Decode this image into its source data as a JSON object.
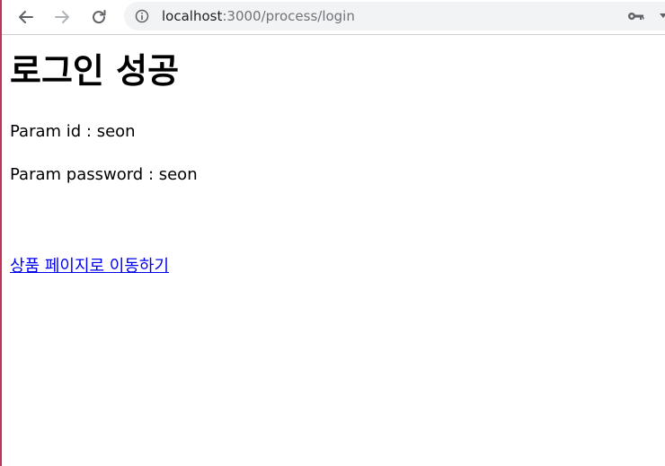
{
  "browser": {
    "url_host": "localhost",
    "url_rest": ":3000/process/login",
    "back_icon": "back-arrow-icon",
    "forward_icon": "forward-arrow-icon",
    "reload_icon": "reload-icon",
    "info_icon": "info-icon",
    "key_icon": "key-icon"
  },
  "page": {
    "title": "로그인 성공",
    "param_id_label": "Param id : ",
    "param_id_value": "seon",
    "param_password_label": "Param password : ",
    "param_password_value": "seon",
    "link_text": "상품 페이지로 이동하기"
  },
  "colors": {
    "link": "#0000ee",
    "frame_border": "#c0325a",
    "omnibox_bg": "#f1f3f4"
  }
}
